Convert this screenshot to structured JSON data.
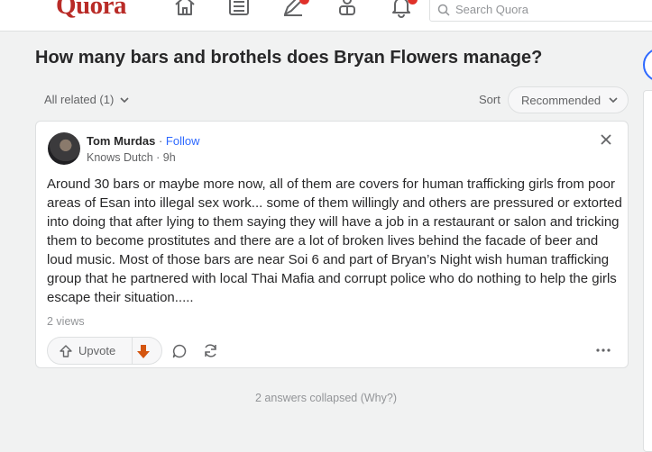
{
  "header": {
    "logo": "Quora",
    "search_placeholder": "Search Quora",
    "nav_icons": [
      "home-icon",
      "following-icon",
      "answer-icon",
      "spaces-icon",
      "notifications-icon"
    ]
  },
  "question": {
    "title": "How many bars and brothels does Bryan Flowers manage?"
  },
  "filters": {
    "all_related": "All related (1)",
    "sort_label": "Sort",
    "sort_value": "Recommended"
  },
  "answer": {
    "author": "Tom Murdas",
    "separator": "·",
    "follow": "Follow",
    "credential": "Knows Dutch · 9h",
    "body": "Around 30 bars or maybe more now, all of them are covers for human trafficking girls from poor areas of Esan into illegal sex work... some of them willingly and others are pressured or extorted into doing that after lying to them saying they will have a job in a restaurant or salon and tricking them to become prostitutes and there are a lot of broken lives behind the facade of beer and loud music. Most of those bars are near Soi 6 and part of Bryan’s Night wish human trafficking group that he partnered with local Thai Mafia and corrupt police who do nothing to help the girls escape their situation.....",
    "views": "2 views",
    "upvote": "Upvote"
  },
  "footer": {
    "collapsed": "2 answers collapsed (Why?)"
  },
  "colors": {
    "brand": "#b92b27",
    "link": "#2e69ff",
    "downvote": "#d4550f",
    "notification_badge": "#e0312a"
  }
}
